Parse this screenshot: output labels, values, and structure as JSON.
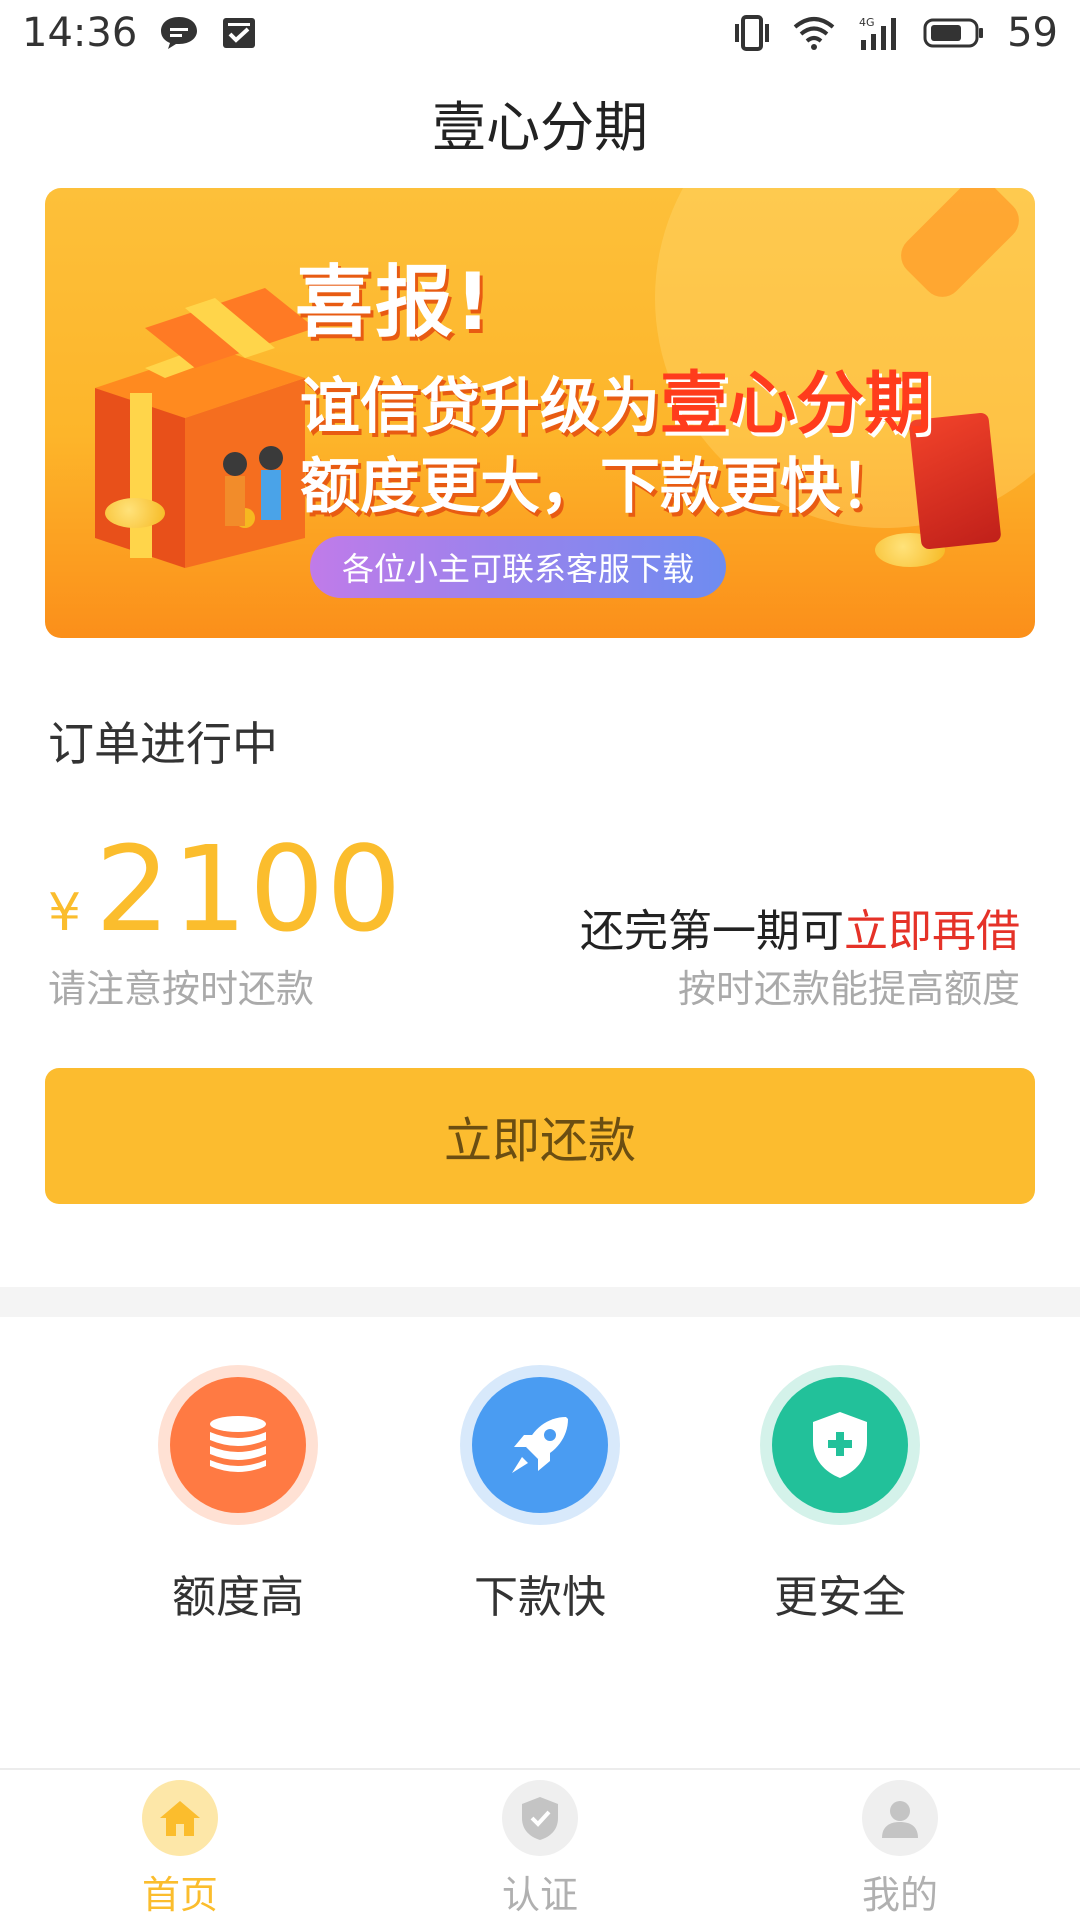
{
  "status_bar": {
    "time": "14:36",
    "battery": "59",
    "left_icons": [
      "chat-icon",
      "mail-check-icon"
    ],
    "right_icons": [
      "vibrate-icon",
      "wifi-icon",
      "signal-4g-icon",
      "battery-icon"
    ]
  },
  "header": {
    "title": "壹心分期"
  },
  "banner": {
    "line1": "喜报!",
    "line2_prefix": "谊信贷升级为",
    "line2_accent": "壹心分期",
    "line3": "额度更大，下款更快！",
    "pill": "各位小主可联系客服下载"
  },
  "order": {
    "title": "订单进行中",
    "currency": "¥",
    "amount": "2100",
    "amount_hint": "请注意按时还款",
    "borrow_prefix": "还完第一期可",
    "borrow_highlight": "立即再借",
    "borrow_hint": "按时还款能提高额度"
  },
  "repay_button": {
    "label": "立即还款"
  },
  "features": [
    {
      "label": "额度高",
      "icon": "coins-stack-icon",
      "color": "#ff7a43",
      "ring": "#ffe1d4"
    },
    {
      "label": "下款快",
      "icon": "rocket-icon",
      "color": "#4a9cf2",
      "ring": "#d8e9fb"
    },
    {
      "label": "更安全",
      "icon": "shield-plus-icon",
      "color": "#22c19a",
      "ring": "#d4f2ea"
    }
  ],
  "bottom_nav": [
    {
      "label": "首页",
      "icon": "home-icon",
      "active": true,
      "color": "#fbbd2d"
    },
    {
      "label": "认证",
      "icon": "shield-check-icon",
      "active": false,
      "color": "#b8b8b8"
    },
    {
      "label": "我的",
      "icon": "user-icon",
      "active": false,
      "color": "#b8b8b8"
    }
  ],
  "colors": {
    "accent": "#fbbd2d",
    "highlight_red": "#e53228",
    "hint_gray": "#aaaaaa"
  }
}
